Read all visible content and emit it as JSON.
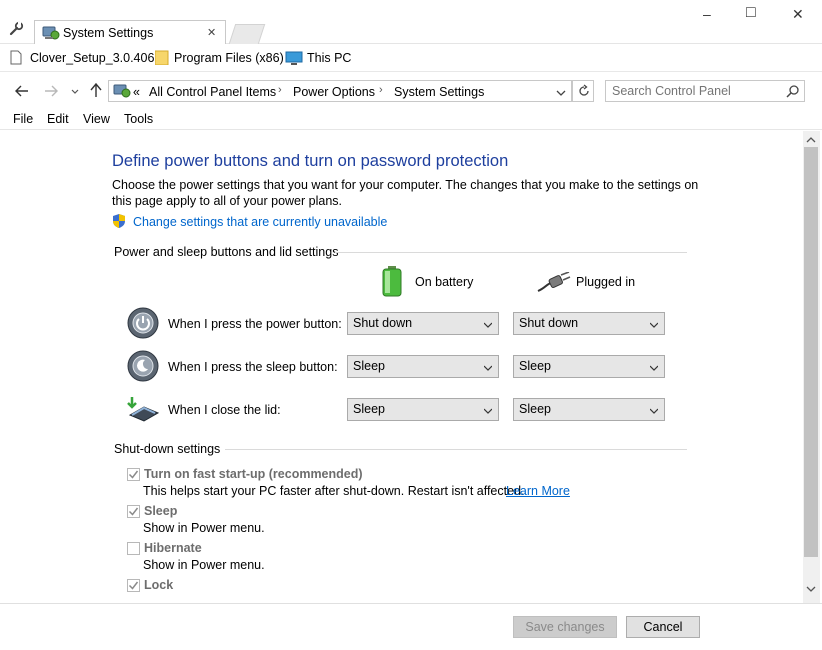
{
  "window": {
    "tab_title": "System Settings",
    "controls": {
      "minimize": "–",
      "maximize": "□",
      "close": "✕"
    },
    "tab_close": "✕"
  },
  "favorites": [
    {
      "label": "Clover_Setup_3.0.406",
      "icon": "file-icon"
    },
    {
      "label": "Program Files (x86)",
      "icon": "folder-icon"
    },
    {
      "label": "This PC",
      "icon": "computer-icon"
    }
  ],
  "nav": {
    "breadcrumb_prefix": "«",
    "breadcrumbs": [
      "All Control Panel Items",
      "Power Options",
      "System Settings"
    ],
    "breadcrumb_separator": "›",
    "search_placeholder": "Search Control Panel"
  },
  "menu": [
    "File",
    "Edit",
    "View",
    "Tools"
  ],
  "page": {
    "title": "Define power buttons and turn on password protection",
    "description_line1": "Choose the power settings that you want for your computer. The changes that you make to the settings on",
    "description_line2": "this page apply to all of your power plans.",
    "admin_link": "Change settings that are currently unavailable"
  },
  "power_section": {
    "heading": "Power and sleep buttons and lid settings",
    "col_battery": "On battery",
    "col_plugged": "Plugged in",
    "rows": [
      {
        "label": "When I press the power button:",
        "battery": "Shut down",
        "plugged": "Shut down"
      },
      {
        "label": "When I press the sleep button:",
        "battery": "Sleep",
        "plugged": "Sleep"
      },
      {
        "label": "When I close the lid:",
        "battery": "Sleep",
        "plugged": "Sleep"
      }
    ]
  },
  "shutdown_section": {
    "heading": "Shut-down settings",
    "options": [
      {
        "label": "Turn on fast start-up (recommended)",
        "checked": true,
        "desc": "This helps start your PC faster after shut-down. Restart isn't affected.",
        "link": "Learn More"
      },
      {
        "label": "Sleep",
        "checked": true,
        "desc": "Show in Power menu."
      },
      {
        "label": "Hibernate",
        "checked": false,
        "desc": "Show in Power menu."
      },
      {
        "label": "Lock",
        "checked": true,
        "desc": ""
      }
    ]
  },
  "footer": {
    "save_label": "Save changes",
    "cancel_label": "Cancel"
  },
  "colors": {
    "title_blue": "#1e3f9e",
    "link_blue": "#0066cc",
    "disabled_text": "#6d6d6d"
  }
}
